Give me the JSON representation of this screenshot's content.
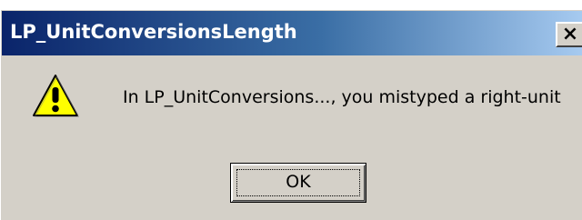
{
  "window": {
    "title": "LP_UnitConversionsLength",
    "close_glyph": "×",
    "titlebar_color_start": "#0a246a",
    "titlebar_color_end": "#a6caf0",
    "background": "#d4d0c8"
  },
  "dialog": {
    "icon": "warning-icon",
    "message": "In LP_UnitConversions..., you mistyped a right-unit",
    "ok_label": "OK"
  }
}
